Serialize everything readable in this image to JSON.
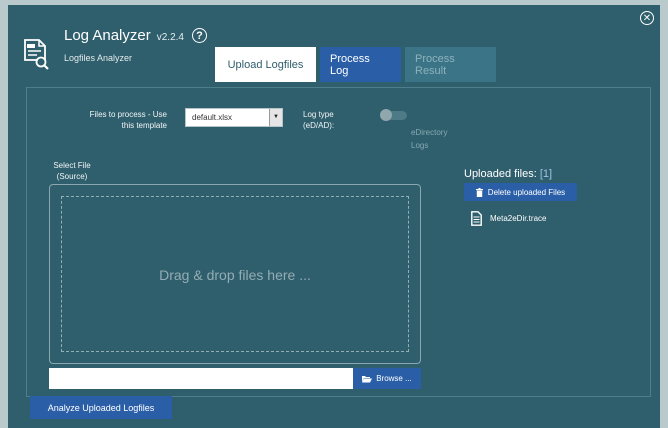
{
  "app": {
    "title": "Log Analyzer",
    "version": "v2.2.4",
    "help_symbol": "?",
    "subtitle": "Logfiles Analyzer",
    "close_symbol": "✕",
    "icon": "document-search-icon"
  },
  "tabs": [
    {
      "label": "Upload Logfiles",
      "state": "active"
    },
    {
      "label": "Process Log",
      "state": "enabled"
    },
    {
      "label": "Process Result",
      "state": "disabled"
    }
  ],
  "form": {
    "files_label_line1": "Files to process - Use",
    "files_label_line2": "this template",
    "template_select_value": "default.xlsx",
    "log_type_label_line1": "Log type",
    "log_type_label_line2": "(eD/AD):",
    "log_type_toggle_text_line1": "eDirectory",
    "log_type_toggle_text_line2": "Logs",
    "log_type_toggle_on": false,
    "select_file_label_line1": "Select File",
    "select_file_label_line2": "(Source)",
    "dropzone_text": "Drag & drop files here ...",
    "file_input_value": "",
    "browse_label": "Browse ..."
  },
  "uploaded": {
    "title": "Uploaded files: ",
    "count": "[1]",
    "delete_label": "Delete uploaded Files",
    "files": [
      "Meta2eDir.trace"
    ]
  },
  "actions": {
    "analyze_label": "Analyze Uploaded Logfiles"
  },
  "colors": {
    "panel": "#2f5e6c",
    "accent_blue": "#2a5fa8",
    "background": "#b9c9cc"
  }
}
